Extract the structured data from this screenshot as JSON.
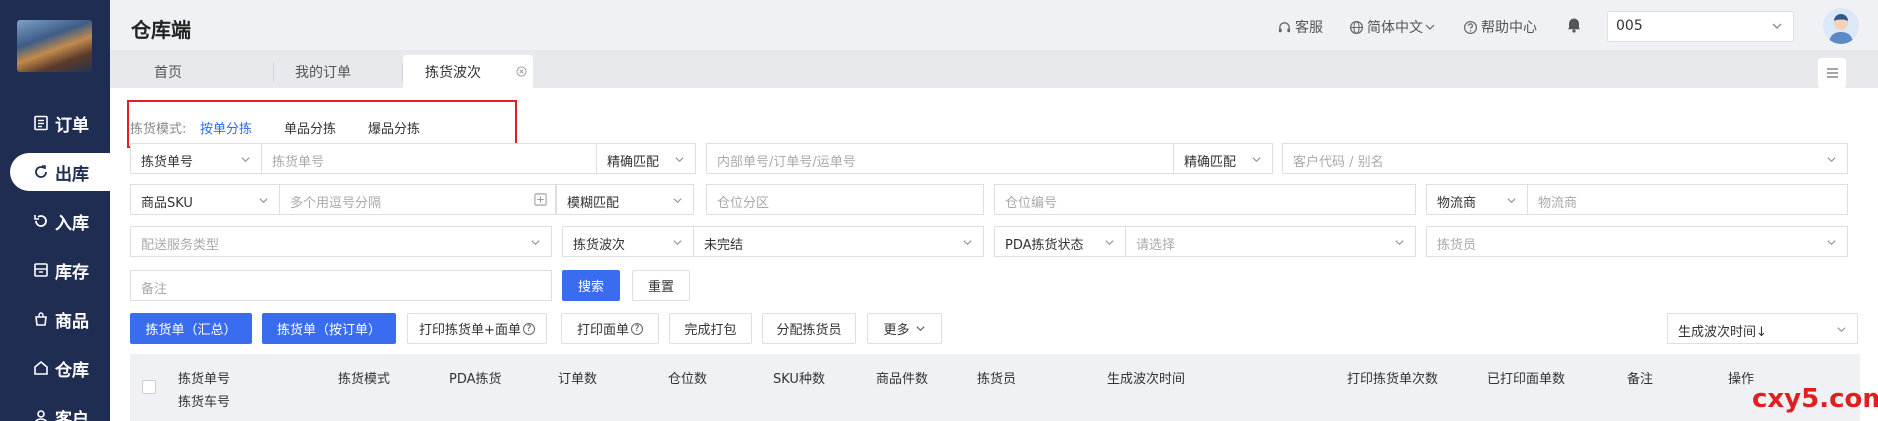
{
  "app_title": "仓库端",
  "sidebar": {
    "items": [
      {
        "label": "订单",
        "icon": "order-icon"
      },
      {
        "label": "出库",
        "icon": "outbound-icon",
        "active": true
      },
      {
        "label": "入库",
        "icon": "inbound-icon"
      },
      {
        "label": "库存",
        "icon": "inventory-icon"
      },
      {
        "label": "商品",
        "icon": "product-icon"
      },
      {
        "label": "仓库",
        "icon": "warehouse-icon"
      },
      {
        "label": "客户",
        "icon": "customer-icon"
      }
    ]
  },
  "header": {
    "support": "客服",
    "language": "简体中文",
    "help": "帮助中心",
    "store_value": "005"
  },
  "tabs": [
    {
      "label": "首页"
    },
    {
      "label": "我的订单"
    },
    {
      "label": "拣货波次",
      "active": true
    }
  ],
  "pick_mode": {
    "label": "拣货模式:",
    "options": [
      "按单分拣",
      "单品分拣",
      "爆品分拣"
    ],
    "selected": "按单分拣"
  },
  "filters": {
    "row1": {
      "field_type": "拣货单号",
      "field_ph": "拣货单号",
      "match1": "精确匹配",
      "order_ph": "内部单号/订单号/运单号",
      "match2": "精确匹配",
      "customer_ph": "客户代码 / 别名"
    },
    "row2": {
      "sku_type": "商品SKU",
      "sku_ph": "多个用逗号分隔",
      "match": "模糊匹配",
      "zone_ph": "仓位分区",
      "loc_ph": "仓位编号",
      "carrier_type": "物流商",
      "carrier_ph": "物流商"
    },
    "row3": {
      "service_ph": "配送服务类型",
      "wave_type": "拣货波次",
      "wave_value": "未完结",
      "pda_type": "PDA拣货状态",
      "pda_ph": "请选择",
      "picker_ph": "拣货员"
    },
    "row4": {
      "remark_ph": "备注",
      "search": "搜索",
      "reset": "重置"
    }
  },
  "actions": {
    "summary": "拣货单（汇总）",
    "by_order": "拣货单（按订单）",
    "print_pick_sheet": "打印拣货单+面单",
    "print_label": "打印面单",
    "complete_pack": "完成打包",
    "assign_picker": "分配拣货员",
    "more": "更多",
    "sort": "生成波次时间↓"
  },
  "table": {
    "headers": [
      "拣货单号",
      "拣货车号",
      "拣货模式",
      "PDA拣货",
      "订单数",
      "仓位数",
      "SKU种数",
      "商品件数",
      "拣货员",
      "生成波次时间",
      "打印拣货单次数",
      "已打印面单数",
      "备注",
      "操作"
    ]
  },
  "watermark": "cxy5.com",
  "colors": {
    "sidebar": "#1f2d52",
    "primary": "#3a6cf0",
    "highlight": "#e02020"
  }
}
